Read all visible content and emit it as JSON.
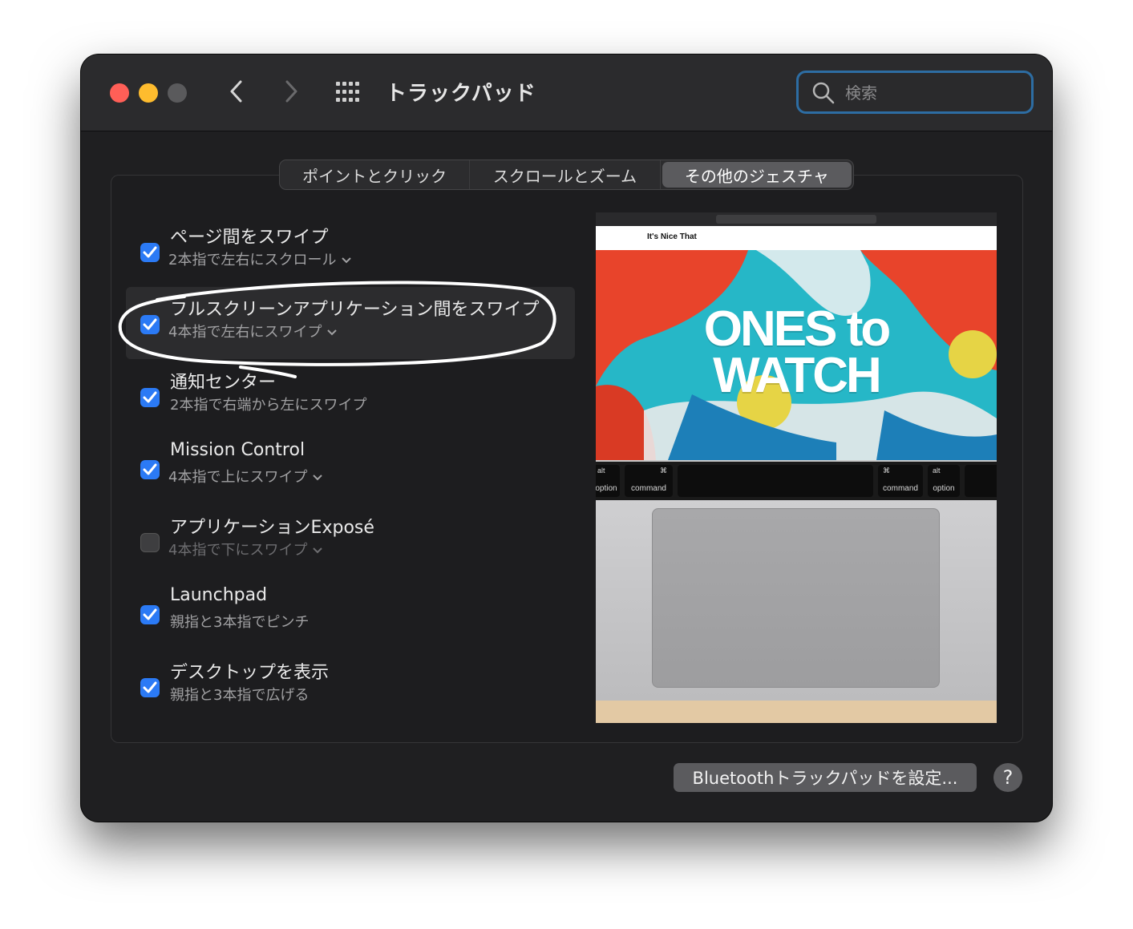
{
  "window": {
    "title": "トラックパッド"
  },
  "search": {
    "placeholder": "検索"
  },
  "tabs": [
    {
      "label": "ポイントとクリック"
    },
    {
      "label": "スクロールとズーム"
    },
    {
      "label": "その他のジェスチャ",
      "active": true
    }
  ],
  "options": [
    {
      "label": "ページ間をスワイプ",
      "sub": "2本指で左右にスクロール",
      "checked": true,
      "has_menu": true
    },
    {
      "label": "フルスクリーンアプリケーション間をスワイプ",
      "sub": "4本指で左右にスワイプ",
      "checked": true,
      "has_menu": true
    },
    {
      "label": "通知センター",
      "sub": "2本指で右端から左にスワイプ",
      "checked": true,
      "has_menu": false
    },
    {
      "label": "Mission Control",
      "sub": "4本指で上にスワイプ",
      "checked": true,
      "has_menu": true
    },
    {
      "label": "アプリケーションExposé",
      "sub": "4本指で下にスワイプ",
      "checked": false,
      "has_menu": true
    },
    {
      "label": "Launchpad",
      "sub": "親指と3本指でピンチ",
      "checked": true,
      "has_menu": false
    },
    {
      "label": "デスクトップを表示",
      "sub": "親指と3本指で広げる",
      "checked": true,
      "has_menu": false
    }
  ],
  "preview": {
    "site_logo": "It's Nice That",
    "headline_line1": "ONES to",
    "headline_line2": "WATCH",
    "keys": {
      "option_left": "option",
      "command_left": "command",
      "command_right": "command",
      "option_right": "option",
      "alt": "alt",
      "cmd_symbol": "⌘"
    }
  },
  "footer": {
    "bluetooth_label": "Bluetoothトラックパッドを設定...",
    "help_label": "?"
  },
  "colors": {
    "accent": "#2b7af5",
    "close": "#ff5f57",
    "minimize": "#febc2e",
    "search_focus": "#2d6da3"
  }
}
